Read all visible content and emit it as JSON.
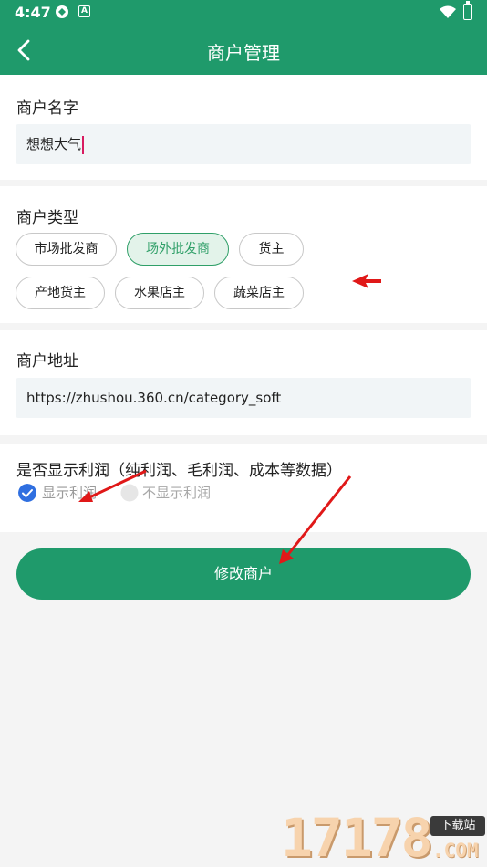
{
  "status_bar": {
    "time": "4:47"
  },
  "header": {
    "title": "商户管理"
  },
  "merchant_name": {
    "label": "商户名字",
    "value": "想想大气"
  },
  "merchant_type": {
    "label": "商户类型",
    "options": [
      {
        "label": "市场批发商",
        "selected": false
      },
      {
        "label": "场外批发商",
        "selected": true
      },
      {
        "label": "货主",
        "selected": false
      },
      {
        "label": "产地货主",
        "selected": false
      },
      {
        "label": "水果店主",
        "selected": false
      },
      {
        "label": "蔬菜店主",
        "selected": false
      }
    ]
  },
  "merchant_address": {
    "label": "商户地址",
    "value": "https://zhushou.360.cn/category_soft"
  },
  "show_profit": {
    "label": "是否显示利润（纯利润、毛利润、成本等数据）",
    "options": [
      {
        "label": "显示利润",
        "selected": true
      },
      {
        "label": "不显示利润",
        "selected": false
      }
    ]
  },
  "submit_label": "修改商户",
  "watermark": {
    "digits": "17178",
    "tag": "下载站",
    "suffix": ".COM"
  },
  "colors": {
    "primary": "#1f9a6b",
    "chip_selected_bg": "#e3f3ea",
    "radio_checked": "#2f6fe0",
    "annotation": "#e01818"
  }
}
